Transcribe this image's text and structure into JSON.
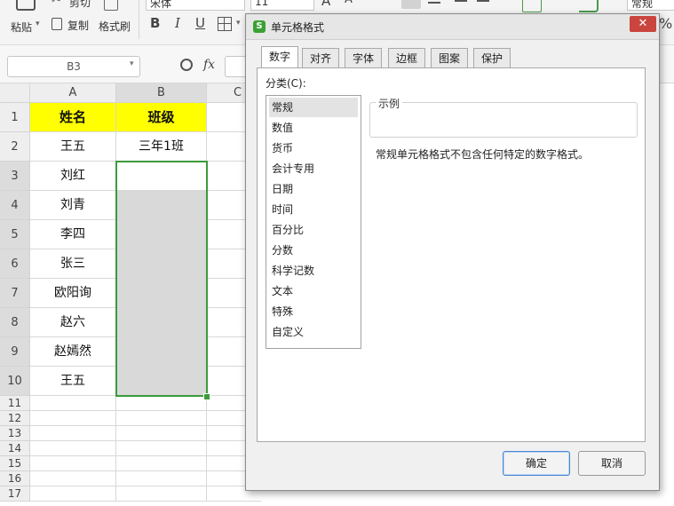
{
  "ribbon": {
    "paste_label": "粘贴",
    "cut_label": "剪切",
    "copy_label": "复制",
    "format_painter_label": "格式刷",
    "font_name": "宋体",
    "font_size": "11",
    "bold": "B",
    "italic": "I",
    "underline": "U",
    "grow_font": "A",
    "shrink_font": "A",
    "number_format": "常规",
    "percent": "%"
  },
  "formula_bar": {
    "name_box": "B3",
    "fx": "fx"
  },
  "sheet": {
    "columns": [
      "A",
      "B",
      "C"
    ],
    "row_numbers": [
      "1",
      "2",
      "3",
      "4",
      "5",
      "6",
      "7",
      "8",
      "9",
      "10",
      "11",
      "12",
      "13",
      "14",
      "15",
      "16",
      "17"
    ],
    "cells": {
      "a1": "姓名",
      "b1": "班级",
      "a2": "王五",
      "b2": "三年1班",
      "a3": "刘红",
      "a4": "刘青",
      "a5": "李四",
      "a6": "张三",
      "a7": "欧阳询",
      "a8": "赵六",
      "a9": "赵嫣然",
      "a10": "王五"
    }
  },
  "dialog": {
    "title": "单元格格式",
    "tabs": [
      "数字",
      "对齐",
      "字体",
      "边框",
      "图案",
      "保护"
    ],
    "category_label": "分类(C):",
    "categories": [
      "常规",
      "数值",
      "货币",
      "会计专用",
      "日期",
      "时间",
      "百分比",
      "分数",
      "科学记数",
      "文本",
      "特殊",
      "自定义"
    ],
    "sample_label": "示例",
    "description": "常规单元格格式不包含任何特定的数字格式。",
    "ok_label": "确定",
    "cancel_label": "取消",
    "close_glyph": "✕"
  },
  "colors": {
    "header_fill": "#ffff00",
    "selected_fill": "#d9d9d9",
    "selection_border": "#3c9a3c",
    "dialog_icon": "#3aa035",
    "close_button": "#c9453d"
  }
}
